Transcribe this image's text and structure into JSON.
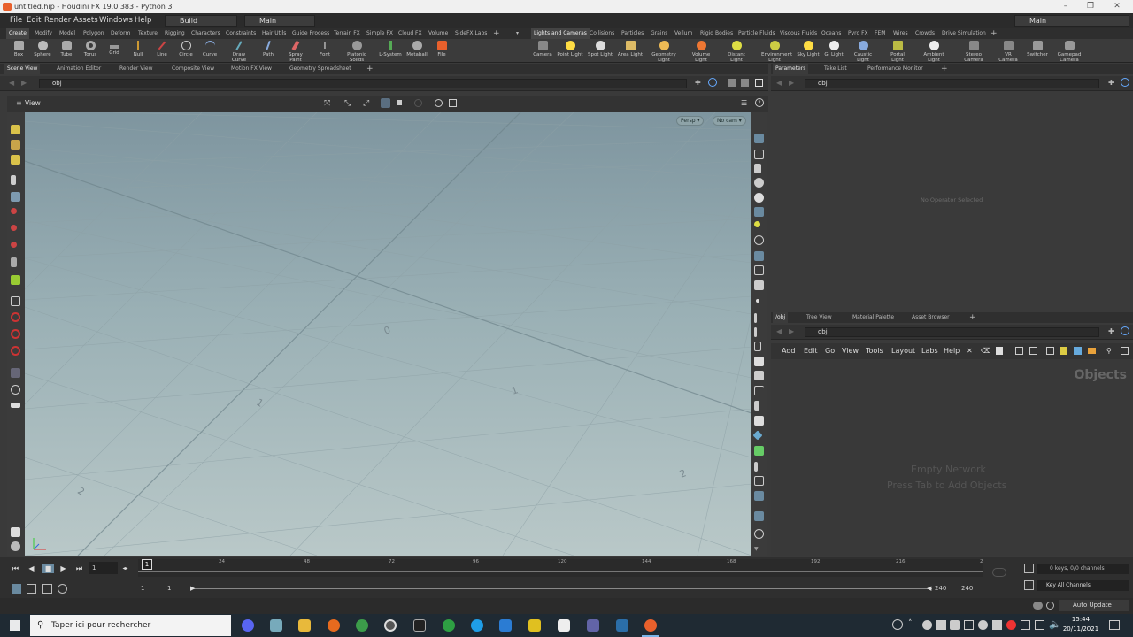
{
  "window": {
    "title": "untitled.hip - Houdini FX 19.0.383 - Python 3"
  },
  "menubar": {
    "items": [
      "File",
      "Edit",
      "Render",
      "Assets",
      "Windows",
      "Help"
    ],
    "desktop_selector": "Build",
    "network_selector": "Main",
    "right_desktop": "Main"
  },
  "shelf_tabs_left": [
    "Create",
    "Modify",
    "Model",
    "Polygon",
    "Deform",
    "Texture",
    "Rigging",
    "Characters",
    "Constraints",
    "Hair Utils",
    "Guide Process",
    "Terrain FX",
    "Simple FX",
    "Cloud FX",
    "Volume",
    "SideFX Labs"
  ],
  "shelf_tabs_right": [
    "Lights and Cameras",
    "Collisions",
    "Particles",
    "Grains",
    "Vellum",
    "Rigid Bodies",
    "Particle Fluids",
    "Viscous Fluids",
    "Oceans",
    "Pyro FX",
    "FEM",
    "Wires",
    "Crowds",
    "Drive Simulation"
  ],
  "shelf_tools_left": [
    "Box",
    "Sphere",
    "Tube",
    "Torus",
    "Grid",
    "Null",
    "Line",
    "Circle",
    "Curve",
    "Draw Curve",
    "Path",
    "Spray Paint",
    "Font",
    "Platonic Solids",
    "L-System",
    "Metaball",
    "File"
  ],
  "shelf_tools_right": [
    "Camera",
    "Point Light",
    "Spot Light",
    "Area Light",
    "Geometry Light",
    "Volume Light",
    "Distant Light",
    "Environment Light",
    "Sky Light",
    "GI Light",
    "Caustic Light",
    "Portal Light",
    "Ambient Light",
    "Stereo Camera",
    "VR Camera",
    "Switcher",
    "Gamepad Camera"
  ],
  "left_pane_tabs": [
    "Scene View",
    "Animation Editor",
    "Render View",
    "Composite View",
    "Motion FX View",
    "Geometry Spreadsheet"
  ],
  "top_right_tabs": [
    "Parameters",
    "Take List",
    "Performance Monitor"
  ],
  "bottom_right_tabs": [
    "/obj",
    "Tree View",
    "Material Palette",
    "Asset Browser"
  ],
  "path": "obj",
  "viewport": {
    "title": "View",
    "persp_button": "Persp ▾",
    "cam_button": "No cam ▾",
    "grid_labels": [
      "0",
      "1",
      "2",
      "1",
      "2"
    ]
  },
  "parameters": {
    "empty_message": "No Operator Selected"
  },
  "network": {
    "menu": [
      "Add",
      "Edit",
      "Go",
      "View",
      "Tools",
      "Layout",
      "Labs",
      "Help"
    ],
    "context_label": "Objects",
    "empty_line1": "Empty Network",
    "empty_line2": "Press Tab to Add Objects"
  },
  "timeline": {
    "current_frame": "1",
    "ticks": [
      "1",
      "24",
      "48",
      "72",
      "96",
      "120",
      "144",
      "168",
      "192",
      "216",
      "2"
    ],
    "range_start": "1",
    "range_start2": "1",
    "range_end": "240",
    "range_end2": "240",
    "keys_info": "0 keys, 0/0 channels",
    "key_all": "Key All Channels",
    "auto_update": "Auto Update"
  },
  "taskbar": {
    "search_placeholder": "Taper ici pour rechercher",
    "time": "15:44",
    "date": "20/11/2021"
  },
  "colors": {
    "accent": "#e8602c",
    "viewport_top": "#7e959f",
    "viewport_bottom": "#b9c8c8"
  }
}
